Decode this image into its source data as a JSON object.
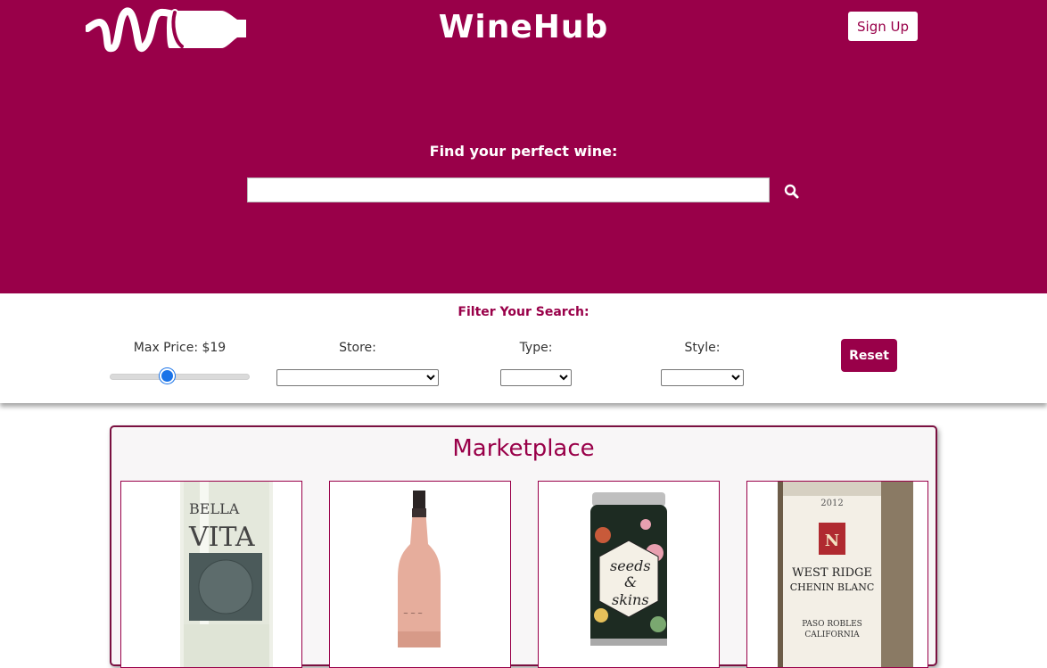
{
  "header": {
    "logo_icon": "winehub-squiggle-bottle-logo",
    "brand": "WineHub",
    "signup_label": "Sign Up"
  },
  "search": {
    "label": "Find your perfect wine:",
    "value": "",
    "placeholder": "",
    "button_icon": "search-icon"
  },
  "filters": {
    "title": "Filter Your Search:",
    "max_price_label": "Max Price: $19",
    "max_price_value": 19,
    "slider_fraction": 0.4,
    "store_label": "Store:",
    "store_value": "",
    "type_label": "Type:",
    "type_value": "",
    "style_label": "Style:",
    "style_value": "",
    "reset_label": "Reset"
  },
  "marketplace": {
    "title": "Marketplace",
    "products": [
      {
        "label_text_1": "BELLA",
        "label_text_2": "VITA",
        "image": "white-wine-bottle"
      },
      {
        "label_text_1": "",
        "label_text_2": "",
        "image": "rose-wine-bottle"
      },
      {
        "label_text_1": "seeds",
        "label_text_2": "skins",
        "label_amp": "&",
        "image": "wine-can"
      },
      {
        "label_text_1": "2012",
        "label_text_2": "WEST RIDGE",
        "label_text_3": "CHENIN BLANC",
        "label_text_4": "PASO ROBLES",
        "label_text_5": "CALIFORNIA",
        "image": "chenin-blanc-bottle"
      }
    ]
  },
  "colors": {
    "brand": "#990049",
    "white": "#ffffff",
    "slider_thumb": "#1a73e8"
  }
}
